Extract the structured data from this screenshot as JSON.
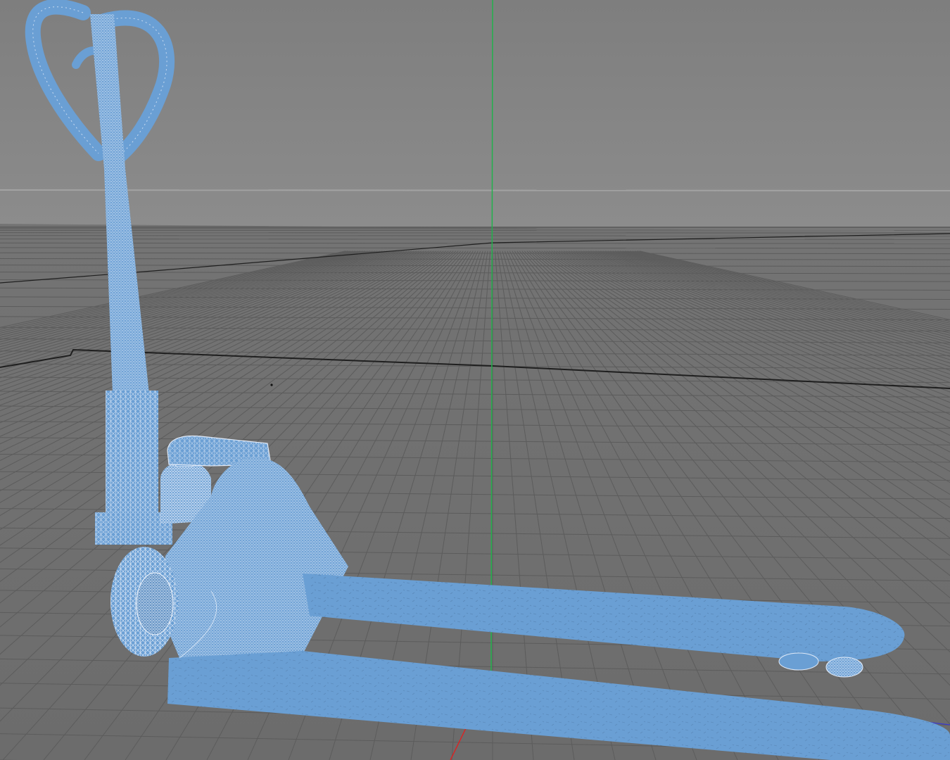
{
  "viewport": {
    "view": "perspective",
    "background_color": "#808080",
    "horizon_color": "#a3a3a3",
    "floor_color": "#6f6f6f",
    "grid_line_color": "#5c5c5c",
    "grid_major_line_color": "#222222",
    "axis_colors": {
      "x": "#e02020",
      "y": "#22b14c",
      "z": "#3a3ad0"
    },
    "grid_visible": true,
    "axis_lines_visible": true
  },
  "model": {
    "icon": "pallet-jack-icon",
    "display_mode": "wireframe-shaded",
    "selected": true,
    "selection_color": "#6a9fd4",
    "wire_color": "#e4eefa"
  }
}
